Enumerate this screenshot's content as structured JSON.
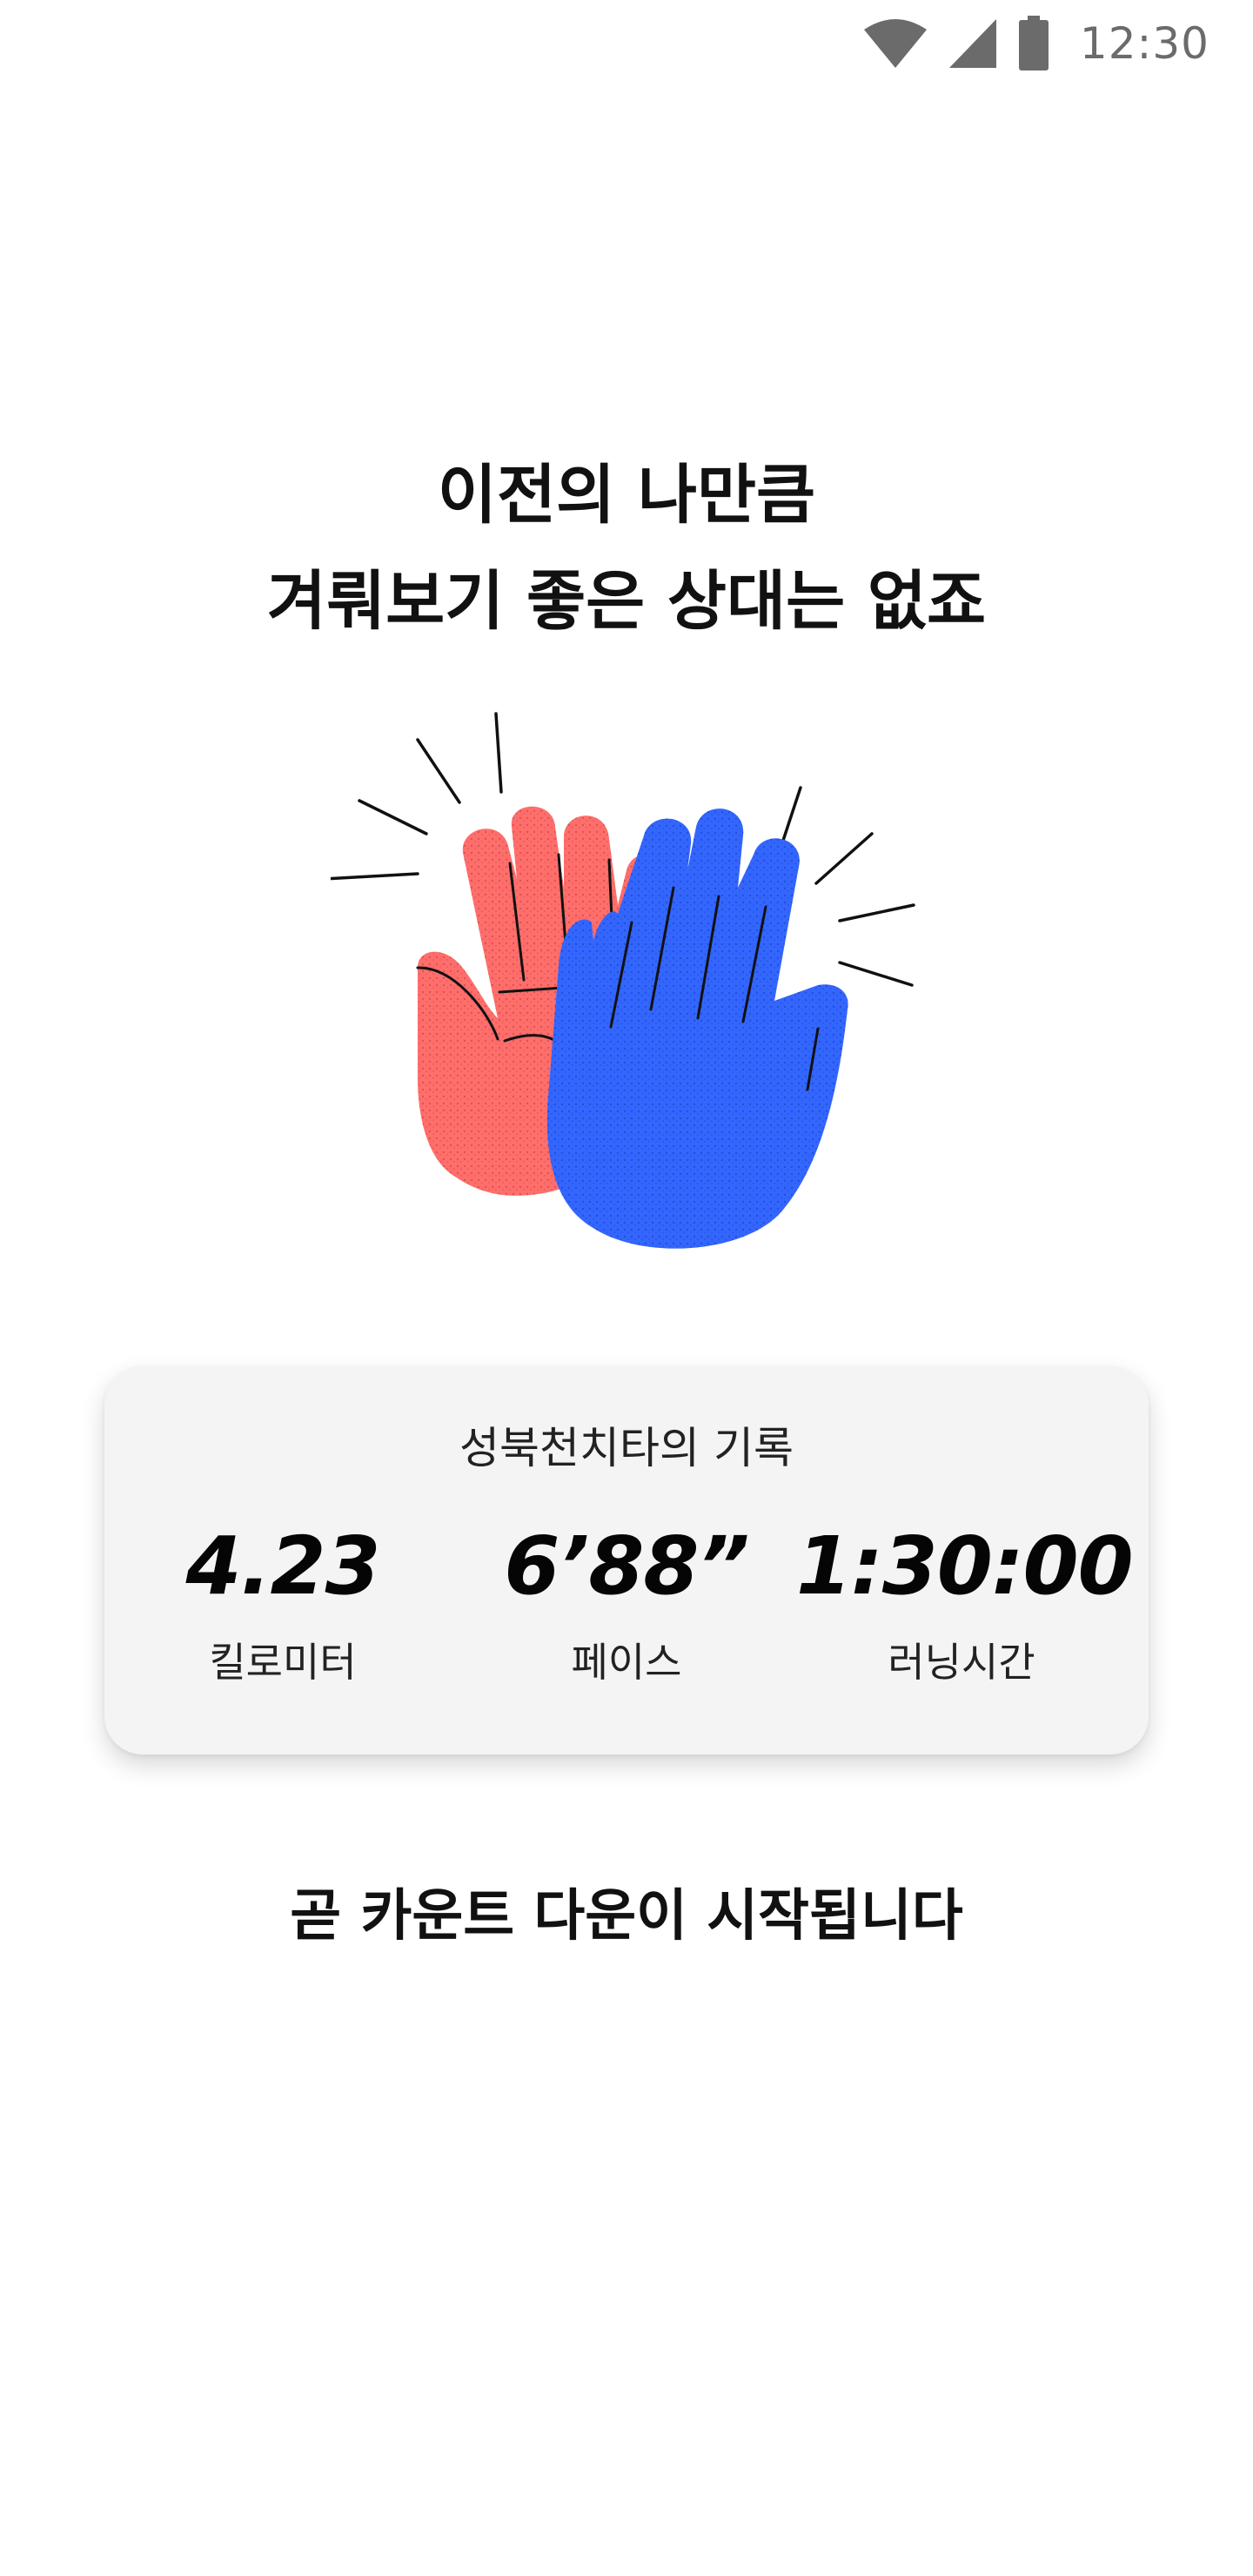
{
  "status_bar": {
    "time": "12:30",
    "icons": [
      "wifi-icon",
      "signal-icon",
      "battery-icon"
    ]
  },
  "headline": {
    "line1": "이전의 나만큼",
    "line2": "겨뤄보기 좋은 상대는 없죠"
  },
  "illustration": {
    "name": "high-five-hands-illustration",
    "colors": {
      "red_hand": "#ff6b6b",
      "blue_hand": "#3366ff",
      "lines": "#111111"
    }
  },
  "record_card": {
    "title": "성북천치타의 기록",
    "stats": [
      {
        "value": "4.23",
        "label": "킬로미터"
      },
      {
        "value": "6’88”",
        "label": "페이스"
      },
      {
        "value": "1:30:00",
        "label": "러닝시간"
      }
    ]
  },
  "countdown_message": "곧 카운트 다운이 시작됩니다"
}
